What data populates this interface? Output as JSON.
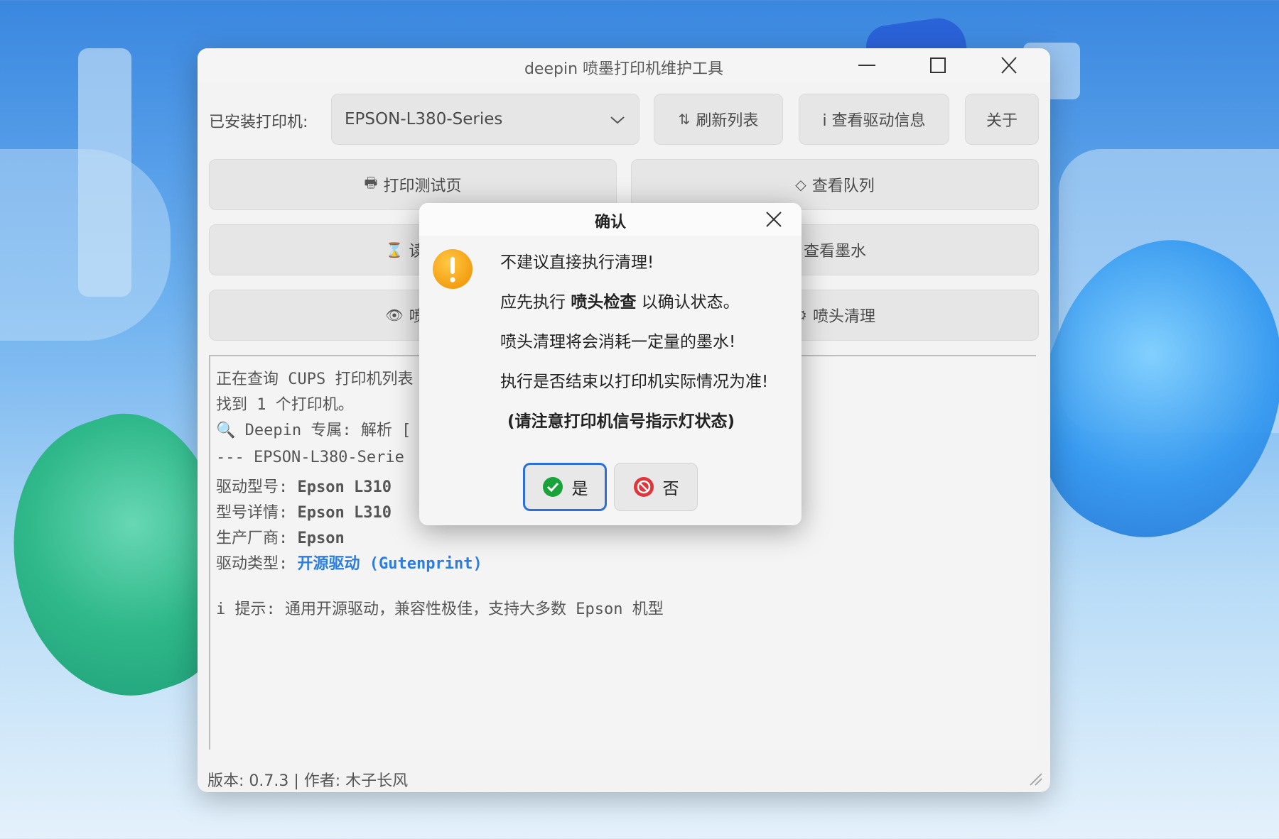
{
  "window": {
    "title": "deepin 喷墨打印机维护工具"
  },
  "toolbar": {
    "printer_label": "已安装打印机:",
    "printer_selected": "EPSON-L380-Series",
    "refresh_label": "刷新列表",
    "driver_info_label": "i 查看驱动信息",
    "about_label": "关于"
  },
  "actions": {
    "print_test": "打印测试页",
    "view_queue": "查看队列",
    "read_partial": "读取",
    "view_ink": "查看墨水",
    "nozzle_check_partial": "喷头",
    "nozzle_clean": "喷头清理"
  },
  "log": {
    "line1": "正在查询 CUPS 打印机列表",
    "line2": "找到 1 个打印机。",
    "line3_prefix": "🔍 Deepin 专属: 解析 [",
    "line4": "--- EPSON-L380-Serie",
    "driver_model_label": "驱动型号: ",
    "driver_model_value": "Epson L310",
    "model_detail_label": "型号详情: ",
    "model_detail_value": "Epson L310",
    "vendor_label": "生产厂商: ",
    "vendor_value": "Epson",
    "driver_type_label": "驱动类型: ",
    "driver_type_value": "开源驱动 (Gutenprint)",
    "hint": "i 提示: 通用开源驱动，兼容性极佳，支持大多数 Epson 机型"
  },
  "status": {
    "text": "版本: 0.7.3 | 作者: 木子长风"
  },
  "dialog": {
    "title": "确认",
    "msg1": "不建议直接执行清理!",
    "msg2_pre": "应先执行 ",
    "msg2_bold": "喷头检查",
    "msg2_post": " 以确认状态。",
    "msg3": "喷头清理将会消耗一定量的墨水!",
    "msg4": "执行是否结束以打印机实际情况为准!",
    "msg5": "(请注意打印机信号指示灯状态)",
    "yes_label": "是",
    "no_label": "否"
  },
  "colors": {
    "accent": "#2c7de0",
    "warning": "#f5a015",
    "yes_icon": "#1aa33a",
    "no_icon": "#e0363b"
  }
}
